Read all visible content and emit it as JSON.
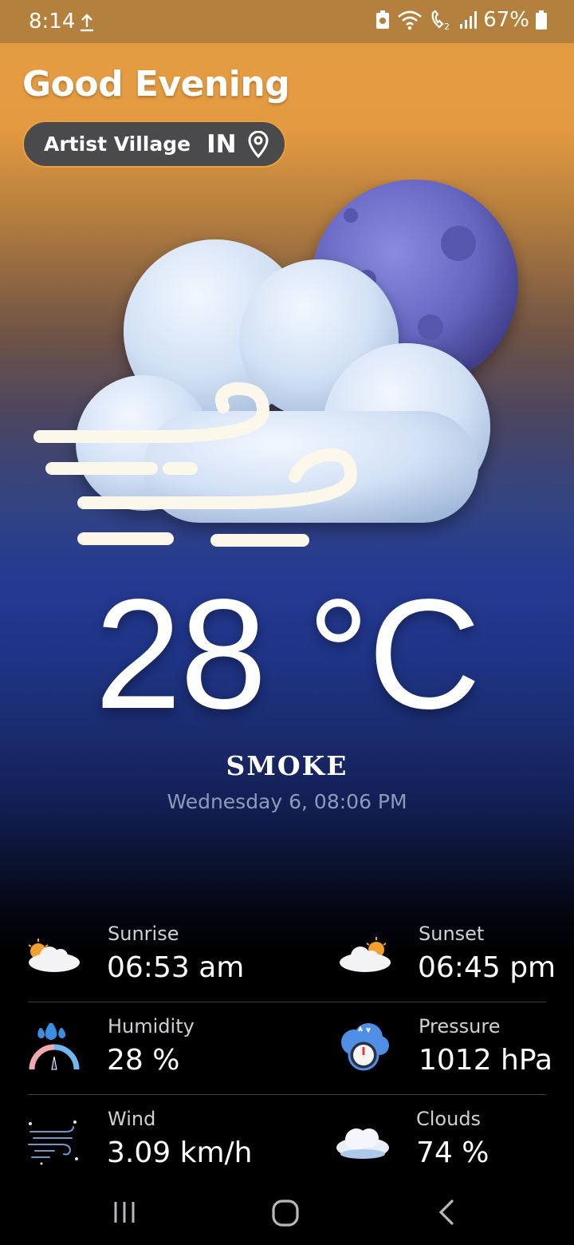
{
  "status_bar": {
    "time": "8:14",
    "battery": "67%"
  },
  "header": {
    "greeting": "Good Evening",
    "city": "Artist Village",
    "country": "IN"
  },
  "weather": {
    "temperature": "28 °C",
    "condition": "SMOKE",
    "datetime": "Wednesday 6, 08:06 PM"
  },
  "stats": {
    "sunrise": {
      "label": "Sunrise",
      "value": "06:53 am"
    },
    "sunset": {
      "label": "Sunset",
      "value": "06:45 pm"
    },
    "humidity": {
      "label": "Humidity",
      "value": "28 %"
    },
    "pressure": {
      "label": "Pressure",
      "value": "1012 hPa"
    },
    "wind": {
      "label": "Wind",
      "value": "3.09 km/h"
    },
    "clouds": {
      "label": "Clouds",
      "value": "74  %"
    }
  },
  "icons": {
    "status": [
      "upload-icon",
      "battery-saver-icon",
      "wifi-icon",
      "wifi-calling-icon",
      "signal-icon",
      "battery-icon"
    ],
    "header": [
      "location-pin-icon"
    ],
    "stats": [
      "sunrise-icon",
      "sunset-icon",
      "humidity-icon",
      "pressure-icon",
      "wind-icon",
      "clouds-icon"
    ],
    "nav": [
      "recent-apps-icon",
      "home-icon",
      "back-icon"
    ]
  },
  "colors": {
    "accent_orange": "#e49c43",
    "night_blue": "#253a92",
    "moon": "#6a6ac4",
    "cloud": "#d4e2f6",
    "pill_bg": "#4a4a4c",
    "datetime_text": "#8f9ab8"
  }
}
